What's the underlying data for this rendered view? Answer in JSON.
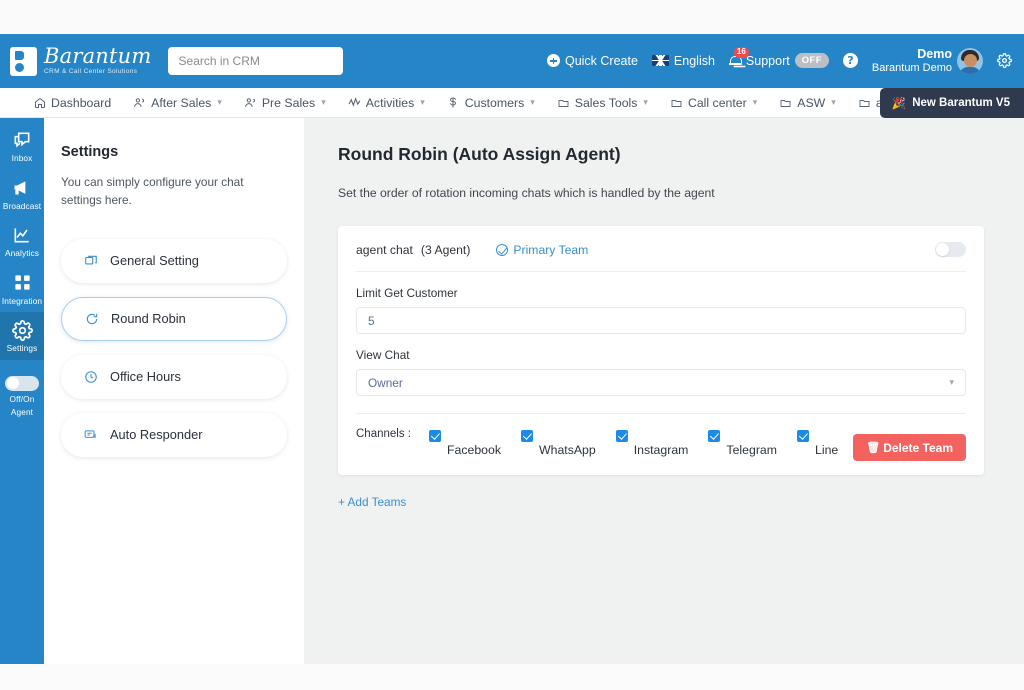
{
  "header": {
    "logo_name": "Barantum",
    "logo_tagline": "CRM & Call Center Solutions",
    "search_placeholder": "Search in CRM",
    "quick_create": "Quick Create",
    "language": "English",
    "notification_count": "16",
    "support_label": "Support",
    "support_state": "OFF",
    "user_name": "Demo",
    "user_org": "Barantum Demo",
    "accent": "#2585c6"
  },
  "navbar": {
    "items": [
      {
        "label": "Dashboard",
        "icon": "home-icon",
        "caret": false
      },
      {
        "label": "After Sales",
        "icon": "people-icon",
        "caret": true
      },
      {
        "label": "Pre Sales",
        "icon": "people-icon",
        "caret": true
      },
      {
        "label": "Activities",
        "icon": "activity-icon",
        "caret": true
      },
      {
        "label": "Customers",
        "icon": "dollar-icon",
        "caret": true
      },
      {
        "label": "Sales Tools",
        "icon": "folder-icon",
        "caret": true
      },
      {
        "label": "Call center",
        "icon": "folder-icon",
        "caret": true
      },
      {
        "label": "ASW",
        "icon": "folder-icon",
        "caret": true
      },
      {
        "label": "asd",
        "icon": "folder-icon",
        "caret": true
      }
    ],
    "promo_button": "New Barantum V5"
  },
  "rail": {
    "items": [
      {
        "label": "Inbox",
        "icon": "chat-icon",
        "active": false
      },
      {
        "label": "Broadcast",
        "icon": "megaphone-icon",
        "active": false
      },
      {
        "label": "Analytics",
        "icon": "chart-icon",
        "active": false
      },
      {
        "label": "Integration",
        "icon": "grid-icon",
        "active": false
      },
      {
        "label": "Settings",
        "icon": "gear-icon",
        "active": true
      }
    ],
    "agent_toggle_label_1": "Off/On",
    "agent_toggle_label_2": "Agent",
    "agent_toggle_on": false
  },
  "settings_panel": {
    "title": "Settings",
    "description": "You can simply configure your chat settings here.",
    "menu": [
      {
        "label": "General Setting",
        "icon": "windows-icon",
        "active": false
      },
      {
        "label": "Round Robin",
        "icon": "refresh-icon",
        "active": true
      },
      {
        "label": "Office Hours",
        "icon": "clock-icon",
        "active": false
      },
      {
        "label": "Auto Responder",
        "icon": "reply-icon",
        "active": false
      }
    ]
  },
  "main": {
    "title": "Round Robin (Auto Assign Agent)",
    "subtitle": "Set the order of rotation incoming chats which is handled by the agent",
    "team": {
      "name": "agent chat",
      "agent_count": "(3 Agent)",
      "primary_label": "Primary Team",
      "enabled": false
    },
    "limit_field": {
      "label": "Limit Get Customer",
      "value": "5"
    },
    "view_chat_field": {
      "label": "View Chat",
      "value": "Owner"
    },
    "channels": {
      "label": "Channels :",
      "items": [
        {
          "label": "Facebook",
          "checked": true
        },
        {
          "label": "WhatsApp",
          "checked": true
        },
        {
          "label": "Instagram",
          "checked": true
        },
        {
          "label": "Telegram",
          "checked": true
        },
        {
          "label": "Line",
          "checked": true
        }
      ]
    },
    "delete_button": "Delete Team",
    "add_teams": "+ Add Teams"
  }
}
